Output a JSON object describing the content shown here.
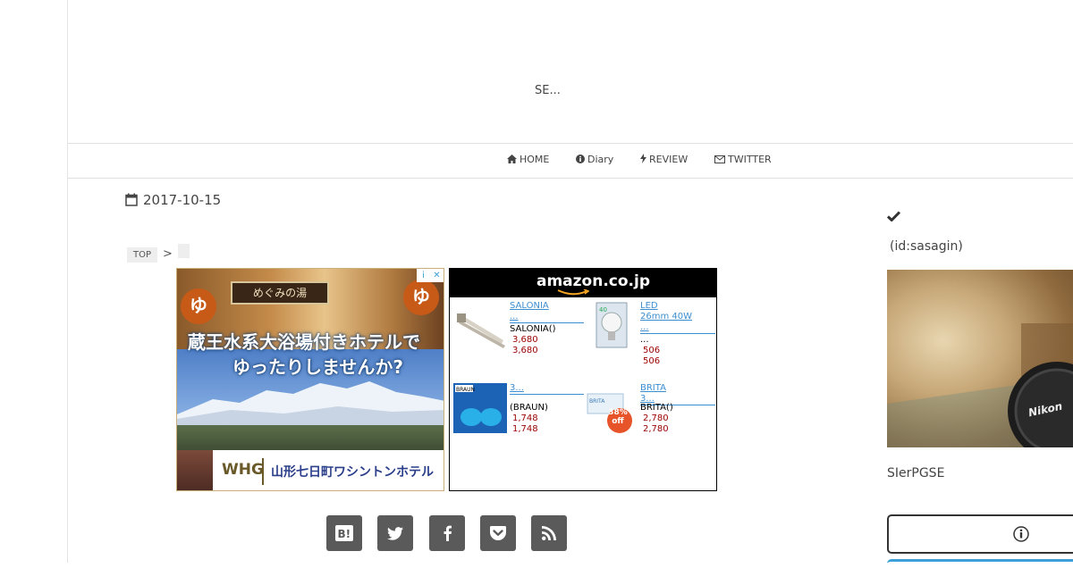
{
  "header": {
    "site_description": "SE..."
  },
  "nav": {
    "items": [
      {
        "label": "HOME",
        "icon": "home-icon"
      },
      {
        "label": "Diary",
        "icon": "info-circle-icon"
      },
      {
        "label": "REVIEW",
        "icon": "bolt-icon"
      },
      {
        "label": "TWITTER",
        "icon": "envelope-icon"
      }
    ]
  },
  "article": {
    "date": "2017-10-15",
    "breadcrumb": {
      "top_label": "TOP",
      "separator": ">"
    }
  },
  "ads": {
    "hotel": {
      "sign_text": "めぐみの湯",
      "mark_text": "ゆ",
      "headline_1": "蔵王水系大浴場付きホテルで",
      "headline_2": "ゆったりしませんか?",
      "logo_text": "WHG",
      "hotel_name": "山形七日町ワシントンホテル",
      "adchoices": [
        "i",
        "✕"
      ]
    },
    "amazon": {
      "logo": "amazon.co.jp",
      "products": [
        {
          "title_1": "SALONIA",
          "title_2": "...",
          "name": "SALONIA()",
          "price_1": "3,680",
          "price_2": "3,680"
        },
        {
          "title_1": "LED",
          "title_2": "26mm 40W",
          "title_3": "...",
          "name": "...",
          "price_1": "506",
          "price_2": "506"
        },
        {
          "title_1": "3...",
          "name": "(BRAUN)",
          "price_1": "1,748",
          "price_2": "1,748"
        },
        {
          "title_1": "BRITA",
          "title_2": "3...",
          "name": "BRITA()",
          "price_1": "2,780",
          "price_2": "2,780",
          "badge": "38% off"
        }
      ]
    }
  },
  "share": [
    {
      "icon": "hatena-bookmark-icon",
      "glyph": "B!"
    },
    {
      "icon": "twitter-icon"
    },
    {
      "icon": "facebook-icon"
    },
    {
      "icon": "pocket-icon"
    },
    {
      "icon": "rss-icon"
    }
  ],
  "sidebar": {
    "check_icon": "check-icon",
    "user_id": "(id:sasagin)",
    "description": "SIerPGSE",
    "button_icon": "info-circle-icon"
  },
  "colors": {
    "accent": "#3da0d8",
    "price": "#9a0000",
    "share_bg": "#5a5a5a"
  }
}
